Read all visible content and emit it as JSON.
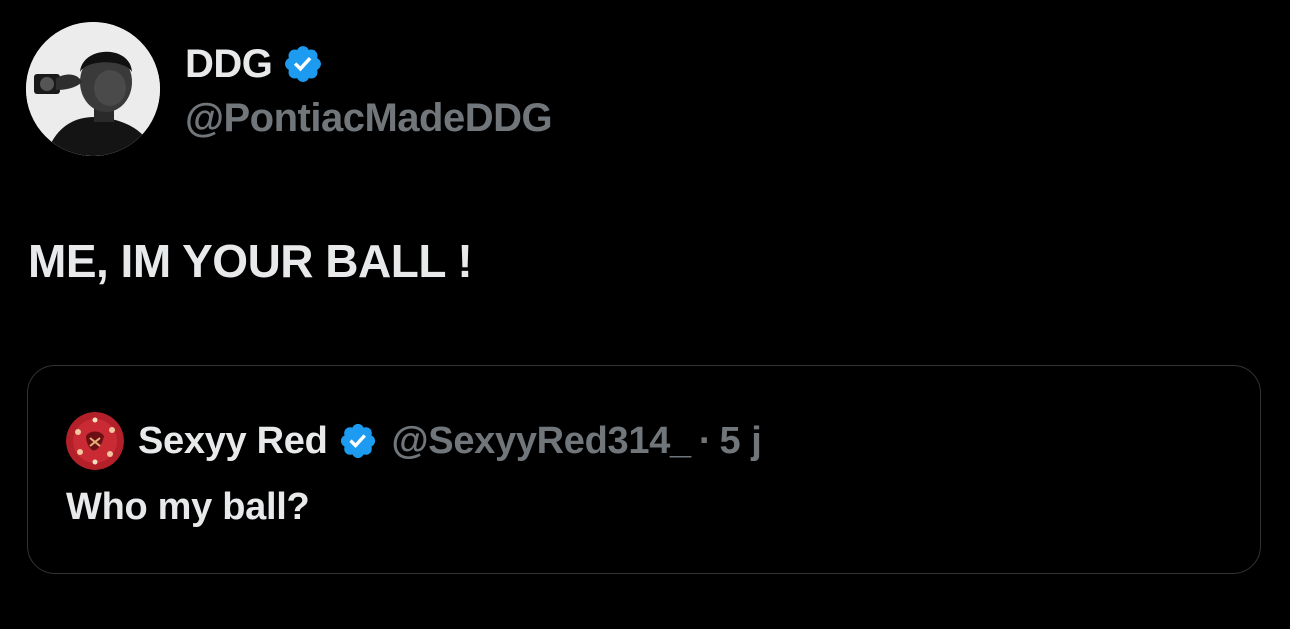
{
  "tweet": {
    "author": {
      "display_name": "DDG",
      "handle": "@PontiacMadeDDG",
      "verified": true,
      "avatar_icon": "profile-photo"
    },
    "text": "ME, IM YOUR BALL !"
  },
  "quoted_tweet": {
    "author": {
      "display_name": "Sexyy Red",
      "handle": "@SexyyRed314_",
      "verified": true,
      "avatar_icon": "profile-photo"
    },
    "separator": "·",
    "timestamp": "5 j",
    "text": "Who my ball?"
  },
  "colors": {
    "background": "#000000",
    "primary_text": "#e7e9ea",
    "secondary_text": "#71767b",
    "verified_badge": "#1d9bf0",
    "card_border": "#2f3336"
  }
}
